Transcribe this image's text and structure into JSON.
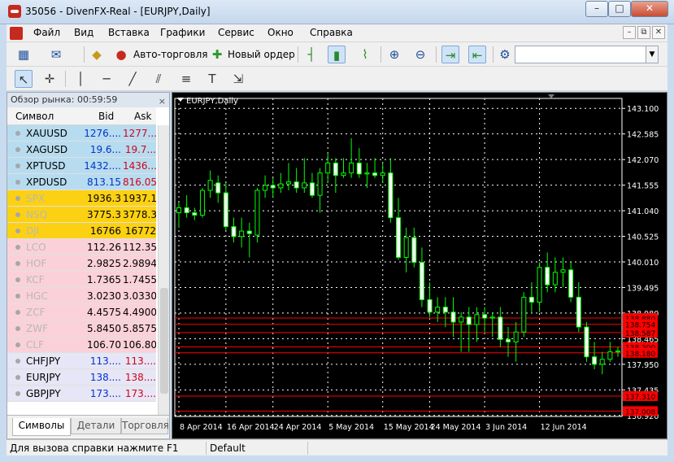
{
  "window": {
    "title": "35056 - DivenFX-Real - [EURJPY,Daily]",
    "minimize_icon": "minimize-icon",
    "maximize_icon": "maximize-icon",
    "close_icon": "close-icon",
    "min_glyph": "–",
    "max_glyph": "□",
    "close_glyph": "✕"
  },
  "menu": {
    "items": [
      "Файл",
      "Вид",
      "Вставка",
      "Графики",
      "Сервис",
      "Окно",
      "Справка"
    ],
    "mdi_min": "–",
    "mdi_restore": "⧉",
    "mdi_close": "✕"
  },
  "toolbar1": {
    "autotrading_label": "Авто-торговля",
    "new_order_label": "Новый ордер",
    "combo_arrow": "▼"
  },
  "market_watch": {
    "title": "Обзор рынка: 00:59:59",
    "close_glyph": "×",
    "columns": [
      "Символ",
      "Bid",
      "Ask"
    ],
    "rows": [
      {
        "symbol": "XAUUSD",
        "bid": "1276....",
        "ask": "1277...."
      },
      {
        "symbol": "XAGUSD",
        "bid": "19.6...",
        "ask": "19.7..."
      },
      {
        "symbol": "XPTUSD",
        "bid": "1432....",
        "ask": "1436...."
      },
      {
        "symbol": "XPDUSD",
        "bid": "813.15",
        "ask": "816.05"
      },
      {
        "symbol": "SPX",
        "bid": "1936.3",
        "ask": "1937.1"
      },
      {
        "symbol": "NSQ",
        "bid": "3775.3",
        "ask": "3778.3"
      },
      {
        "symbol": "DJI",
        "bid": "16766",
        "ask": "16772"
      },
      {
        "symbol": "LCO",
        "bid": "112.26",
        "ask": "112.35"
      },
      {
        "symbol": "HOF",
        "bid": "2.9825",
        "ask": "2.9894"
      },
      {
        "symbol": "KCF",
        "bid": "1.7365",
        "ask": "1.7455"
      },
      {
        "symbol": "HGC",
        "bid": "3.0230",
        "ask": "3.0330"
      },
      {
        "symbol": "ZCF",
        "bid": "4.4575",
        "ask": "4.4900"
      },
      {
        "symbol": "ZWF",
        "bid": "5.8450",
        "ask": "5.8575"
      },
      {
        "symbol": "CLF",
        "bid": "106.70",
        "ask": "106.80"
      },
      {
        "symbol": "CHFJPY",
        "bid": "113....",
        "ask": "113...."
      },
      {
        "symbol": "EURJPY",
        "bid": "138....",
        "ask": "138...."
      },
      {
        "symbol": "GBPJPY",
        "bid": "173....",
        "ask": "173...."
      }
    ],
    "row_colors": {
      "metals": "#b7dcef",
      "indices": "#fcd113",
      "commodities": "#fbd1d9",
      "forex": "#e6e6f6"
    },
    "tabs": [
      "Символы",
      "Детали",
      "Торговля"
    ]
  },
  "chart_data": {
    "type": "candlestick",
    "symbol_label": "EURJPY,Daily",
    "colors": {
      "background": "#000000",
      "bull": "#00ff00",
      "bear": "#ffffff",
      "grid": "#ffffff",
      "level": "#ff0000",
      "level_label_bg": "#ff0000"
    },
    "ylim": [
      136.9,
      143.3
    ],
    "y_ticks": [
      "143.100",
      "142.585",
      "142.070",
      "141.555",
      "141.040",
      "140.525",
      "140.010",
      "139.495",
      "138.980",
      "138.465",
      "137.950",
      "137.435",
      "136.920"
    ],
    "x_ticks": [
      "8 Apr 2014",
      "16 Apr 2014",
      "24 Apr 2014",
      "5 May 2014",
      "15 May 2014",
      "24 May 2014",
      "3 Jun 2014",
      "12 Jun 2014"
    ],
    "x_tick_index": [
      0,
      6,
      12,
      19,
      26,
      32,
      39,
      46
    ],
    "levels": [
      {
        "price": 138.88,
        "label": "138.880"
      },
      {
        "price": 138.754,
        "label": "138.754"
      },
      {
        "price": 138.587,
        "label": "138.587"
      },
      {
        "price": 138.3,
        "label": "138.300"
      },
      {
        "price": 138.18,
        "label": "138.180"
      },
      {
        "price": 137.31,
        "label": "137.310"
      },
      {
        "price": 137.008,
        "label": "137.008"
      }
    ],
    "candles": [
      [
        141.0,
        141.2,
        140.7,
        141.1
      ],
      [
        141.1,
        141.35,
        140.9,
        141.0
      ],
      [
        141.0,
        141.1,
        140.85,
        140.95
      ],
      [
        140.95,
        141.5,
        140.9,
        141.45
      ],
      [
        141.45,
        141.85,
        141.3,
        141.65
      ],
      [
        141.6,
        141.75,
        141.2,
        141.4
      ],
      [
        141.4,
        141.6,
        140.65,
        140.72
      ],
      [
        140.72,
        140.9,
        140.4,
        140.52
      ],
      [
        140.52,
        140.9,
        140.3,
        140.63
      ],
      [
        140.63,
        140.8,
        140.1,
        140.58
      ],
      [
        140.55,
        141.5,
        140.4,
        141.45
      ],
      [
        141.45,
        141.75,
        141.3,
        141.55
      ],
      [
        141.55,
        141.7,
        141.3,
        141.5
      ],
      [
        141.5,
        141.8,
        141.4,
        141.58
      ],
      [
        141.58,
        142.0,
        141.45,
        141.62
      ],
      [
        141.62,
        141.9,
        141.4,
        141.5
      ],
      [
        141.5,
        142.1,
        141.4,
        141.6
      ],
      [
        141.6,
        141.8,
        141.3,
        141.35
      ],
      [
        141.35,
        141.9,
        141.0,
        141.8
      ],
      [
        141.8,
        142.2,
        141.6,
        142.0
      ],
      [
        142.0,
        142.1,
        141.4,
        141.75
      ],
      [
        141.75,
        142.1,
        141.7,
        141.8
      ],
      [
        141.8,
        142.5,
        141.7,
        142.0
      ],
      [
        142.0,
        142.3,
        141.7,
        141.78
      ],
      [
        141.78,
        142.0,
        141.5,
        141.8
      ],
      [
        141.8,
        142.1,
        141.7,
        141.75
      ],
      [
        141.75,
        142.0,
        141.6,
        141.8
      ],
      [
        141.8,
        142.1,
        140.8,
        140.9
      ],
      [
        140.9,
        141.3,
        140.05,
        140.1
      ],
      [
        140.1,
        140.7,
        139.8,
        140.5
      ],
      [
        140.5,
        140.7,
        139.9,
        140.0
      ],
      [
        140.0,
        140.3,
        139.1,
        139.25
      ],
      [
        139.25,
        139.6,
        138.9,
        139.0
      ],
      [
        139.0,
        139.3,
        138.8,
        139.1
      ],
      [
        139.1,
        139.3,
        138.7,
        139.0
      ],
      [
        139.0,
        139.3,
        138.5,
        138.8
      ],
      [
        138.8,
        139.0,
        138.2,
        138.9
      ],
      [
        138.9,
        139.1,
        138.2,
        138.75
      ],
      [
        138.75,
        139.1,
        138.4,
        138.95
      ],
      [
        138.95,
        139.1,
        138.6,
        138.88
      ],
      [
        138.88,
        139.0,
        138.5,
        138.9
      ],
      [
        138.9,
        139.1,
        138.3,
        138.45
      ],
      [
        138.45,
        138.7,
        138.1,
        138.4
      ],
      [
        138.4,
        138.8,
        138.0,
        138.6
      ],
      [
        138.6,
        139.4,
        138.5,
        139.3
      ],
      [
        139.3,
        139.6,
        139.0,
        139.2
      ],
      [
        139.2,
        140.0,
        139.0,
        139.9
      ],
      [
        139.9,
        140.2,
        139.4,
        139.55
      ],
      [
        139.55,
        140.1,
        139.4,
        139.8
      ],
      [
        139.8,
        140.1,
        139.5,
        139.85
      ],
      [
        139.85,
        140.0,
        139.2,
        139.3
      ],
      [
        139.3,
        139.6,
        138.6,
        138.7
      ],
      [
        138.7,
        138.8,
        138.0,
        138.1
      ],
      [
        138.1,
        138.4,
        137.85,
        137.95
      ],
      [
        137.95,
        138.2,
        137.75,
        138.05
      ],
      [
        138.05,
        138.4,
        138.0,
        138.2
      ],
      [
        138.2,
        138.3,
        138.1,
        138.22
      ]
    ]
  },
  "status": {
    "help": "Для вызова справки нажмите F1",
    "profile": "Default"
  }
}
